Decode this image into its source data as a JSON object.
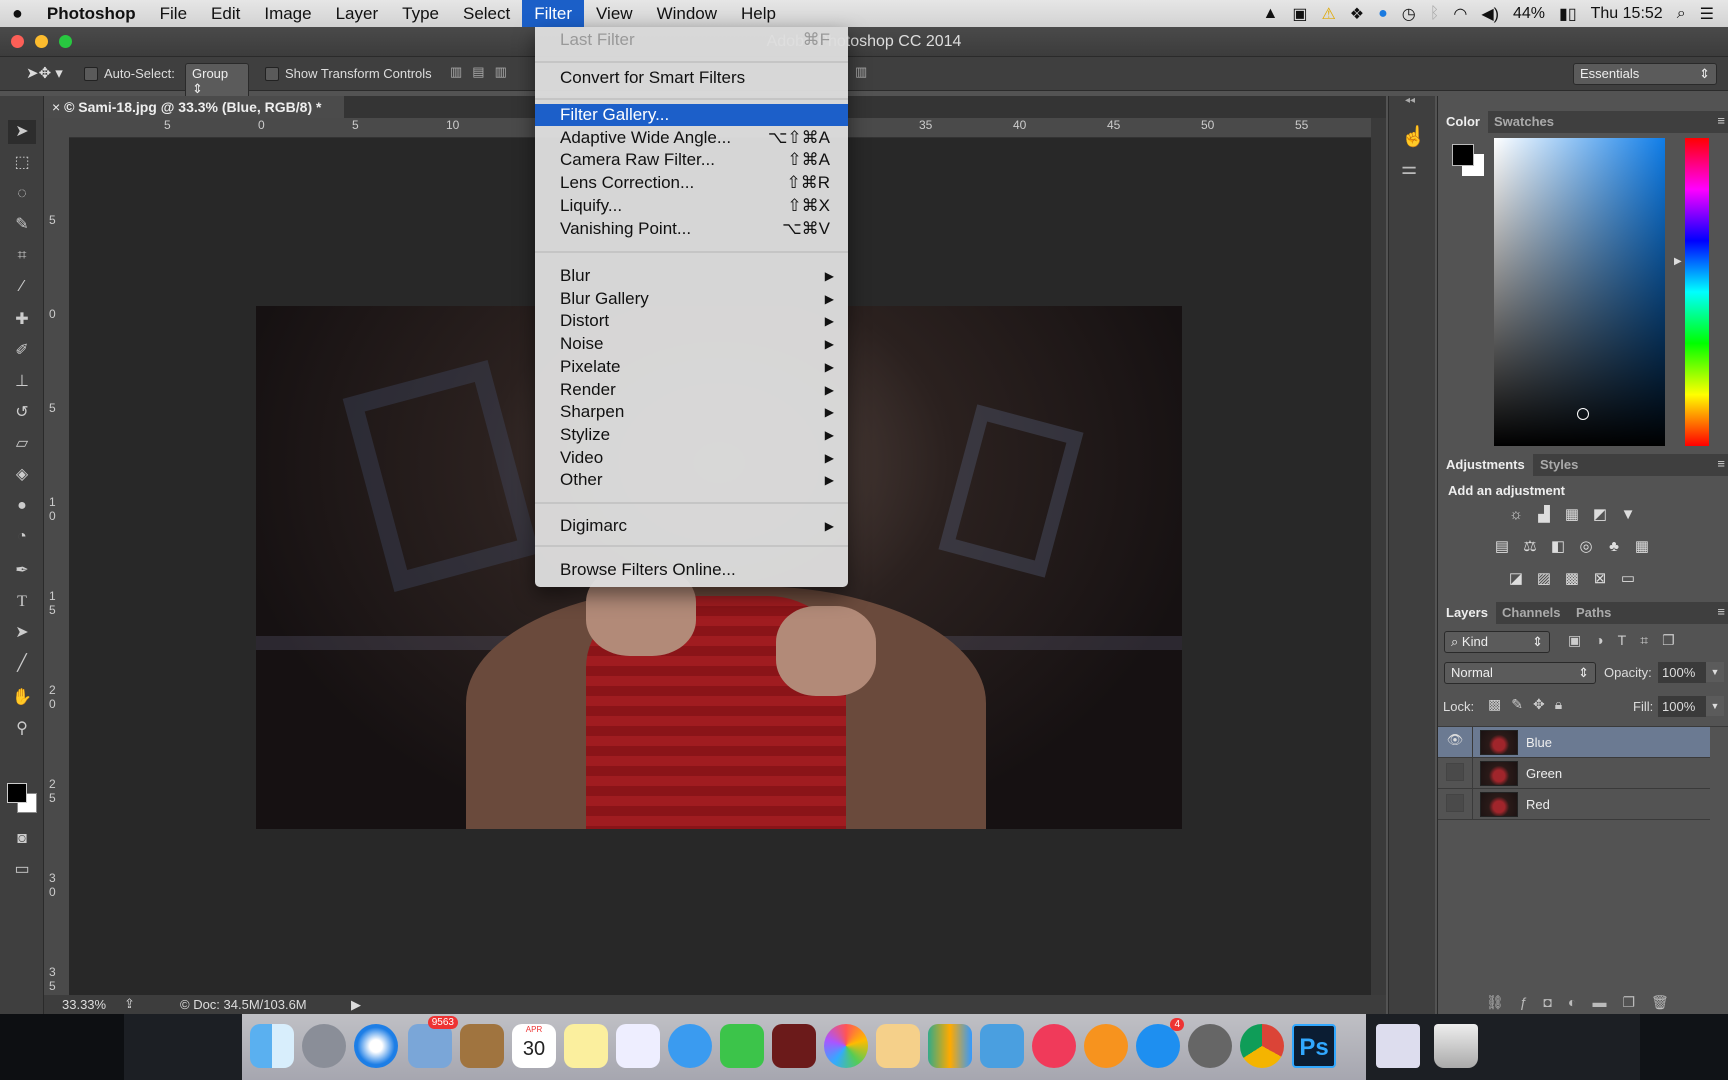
{
  "menubar": {
    "apple": "",
    "app": "Photoshop",
    "items": [
      "File",
      "Edit",
      "Image",
      "Layer",
      "Type",
      "Select",
      "Filter",
      "View",
      "Window",
      "Help"
    ],
    "active": "Filter",
    "battery": "44%",
    "clock": "Thu 15:52"
  },
  "window": {
    "title": "Adobe Photoshop CC 2014"
  },
  "options": {
    "auto_select_label": "Auto-Select:",
    "auto_select_value": "Group",
    "show_transform_label": "Show Transform Controls",
    "workspace": "Essentials"
  },
  "document": {
    "tab": "© Sami-18.jpg @ 33.3% (Blue, RGB/8) *",
    "zoom": "33.33%",
    "doc_info": "© Doc: 34.5M/103.6M"
  },
  "rulers": {
    "h": [
      "5",
      "0",
      "5",
      "10",
      "35",
      "40",
      "45",
      "50",
      "55"
    ],
    "v": [
      "5",
      "0",
      "5",
      "1 0",
      "1 5",
      "2 0",
      "2 5",
      "3 0",
      "3 5"
    ]
  },
  "filter_menu": {
    "last_filter": {
      "label": "Last Filter",
      "shortcut": "⌘F"
    },
    "convert": "Convert for Smart Filters",
    "group1": [
      {
        "label": "Filter Gallery...",
        "shortcut": ""
      },
      {
        "label": "Adaptive Wide Angle...",
        "shortcut": "⌥⇧⌘A"
      },
      {
        "label": "Camera Raw Filter...",
        "shortcut": "⇧⌘A"
      },
      {
        "label": "Lens Correction...",
        "shortcut": "⇧⌘R"
      },
      {
        "label": "Liquify...",
        "shortcut": "⇧⌘X"
      },
      {
        "label": "Vanishing Point...",
        "shortcut": "⌥⌘V"
      }
    ],
    "submenus": [
      "Blur",
      "Blur Gallery",
      "Distort",
      "Noise",
      "Pixelate",
      "Render",
      "Sharpen",
      "Stylize",
      "Video",
      "Other"
    ],
    "digimarc": "Digimarc",
    "browse": "Browse Filters Online...",
    "highlighted": "Filter Gallery..."
  },
  "color_panel": {
    "tabs": [
      "Color",
      "Swatches"
    ],
    "foreground": "#000000",
    "background": "#ffffff"
  },
  "adjustments_panel": {
    "tabs": [
      "Adjustments",
      "Styles"
    ],
    "heading": "Add an adjustment"
  },
  "layers_panel": {
    "tabs": [
      "Layers",
      "Channels",
      "Paths"
    ],
    "filter": "Kind",
    "blend_mode": "Normal",
    "opacity_label": "Opacity:",
    "opacity": "100%",
    "lock_label": "Lock:",
    "fill_label": "Fill:",
    "fill": "100%",
    "layers": [
      {
        "name": "Blue",
        "visible": true,
        "selected": true
      },
      {
        "name": "Green",
        "visible": false,
        "selected": false
      },
      {
        "name": "Red",
        "visible": false,
        "selected": false
      }
    ]
  },
  "dock": {
    "mail_badge": "9563",
    "calendar_month": "APR",
    "calendar_day": "30",
    "appstore_badge": "4",
    "ps_label": "Ps"
  },
  "colors": {
    "menu_highlight": "#1c5fc9",
    "layer_selected": "#6b7a92",
    "panel": "#535353"
  }
}
